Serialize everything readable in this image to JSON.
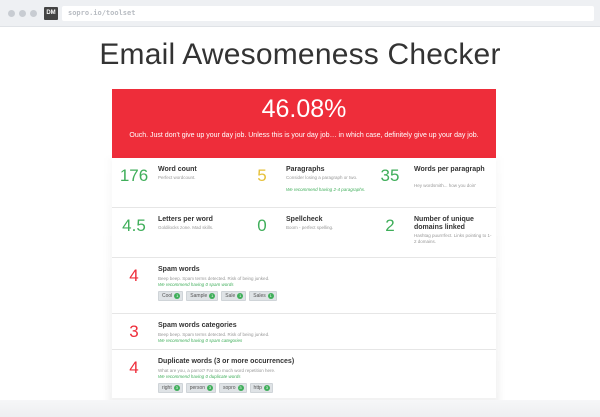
{
  "browser": {
    "favicon_text": "DM",
    "url": "sopro.io/toolset"
  },
  "page": {
    "title": "Email Awesomeness Checker"
  },
  "score": {
    "value": "46.08%",
    "message": "Ouch. Just don't give up your day job. Unless this is your day job… in which case, definitely give up your day job."
  },
  "metrics": {
    "word_count": {
      "value": "176",
      "label": "Word count",
      "desc": "Perfect wordcount."
    },
    "paragraphs": {
      "value": "5",
      "label": "Paragraphs",
      "desc": "Consider losing a paragraph or two.",
      "rec": "We recommend having 2-4 paragraphs."
    },
    "words_per_paragraph": {
      "value": "35",
      "label": "Words per paragraph",
      "desc": "Hey wordsmith... how you doin'"
    },
    "letters_per_word": {
      "value": "4.5",
      "label": "Letters per word",
      "desc": "Goldilocks zone. Mad skills."
    },
    "spellcheck": {
      "value": "0",
      "label": "Spellcheck",
      "desc": "Boom - perfect spelling."
    },
    "unique_domains": {
      "value": "2",
      "label": "Number of unique domains linked",
      "desc": "Hashtag puurrrfect. Links pointing to 1-2 domains."
    },
    "spam_words": {
      "value": "4",
      "label": "Spam words",
      "desc": "Beep beep. Spam terms detected. Risk of being junked.",
      "rec": "We recommend having 0 spam words",
      "tags": [
        {
          "word": "Cool",
          "count": "1"
        },
        {
          "word": "Sample",
          "count": "1"
        },
        {
          "word": "Sale",
          "count": "1"
        },
        {
          "word": "Sales",
          "count": "1"
        }
      ]
    },
    "spam_categories": {
      "value": "3",
      "label": "Spam words categories",
      "desc": "Beep beep. Spam terms detected. Risk of being junked.",
      "rec": "We recommend having 0 spam categories"
    },
    "duplicate_words": {
      "value": "4",
      "label": "Duplicate words (3 or more occurrences)",
      "desc": "What are you, a parrot? Far too much word repetition here.",
      "rec": "We recommend having 0 duplicate words",
      "tags": [
        {
          "word": "right",
          "count": "3"
        },
        {
          "word": "person",
          "count": "3"
        },
        {
          "word": "sopro",
          "count": "3"
        },
        {
          "word": "http",
          "count": "3"
        }
      ]
    }
  },
  "colors": {
    "banner": "#ee2d3a",
    "good": "#3fae5a",
    "warn": "#e6c13b",
    "bad": "#ee2d3a"
  }
}
